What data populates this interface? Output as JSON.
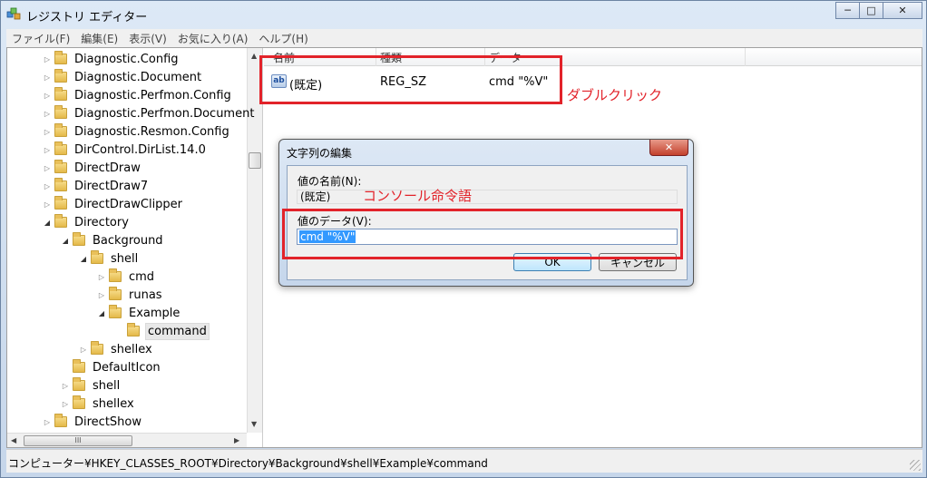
{
  "window": {
    "title": "レジストリ エディター",
    "controls": {
      "minimize": "─",
      "maximize": "□",
      "close": "✕"
    }
  },
  "menu": [
    "ファイル(F)",
    "編集(E)",
    "表示(V)",
    "お気に入り(A)",
    "ヘルプ(H)"
  ],
  "tree": {
    "items": [
      {
        "label": "Diagnostic.Config",
        "depth": 2,
        "expander": "closed"
      },
      {
        "label": "Diagnostic.Document",
        "depth": 2,
        "expander": "closed"
      },
      {
        "label": "Diagnostic.Perfmon.Config",
        "depth": 2,
        "expander": "closed"
      },
      {
        "label": "Diagnostic.Perfmon.Document",
        "depth": 2,
        "expander": "closed"
      },
      {
        "label": "Diagnostic.Resmon.Config",
        "depth": 2,
        "expander": "closed"
      },
      {
        "label": "DirControl.DirList.14.0",
        "depth": 2,
        "expander": "closed"
      },
      {
        "label": "DirectDraw",
        "depth": 2,
        "expander": "closed"
      },
      {
        "label": "DirectDraw7",
        "depth": 2,
        "expander": "closed"
      },
      {
        "label": "DirectDrawClipper",
        "depth": 2,
        "expander": "closed"
      },
      {
        "label": "Directory",
        "depth": 2,
        "expander": "open"
      },
      {
        "label": "Background",
        "depth": 3,
        "expander": "open"
      },
      {
        "label": "shell",
        "depth": 4,
        "expander": "open"
      },
      {
        "label": "cmd",
        "depth": 5,
        "expander": "closed"
      },
      {
        "label": "runas",
        "depth": 5,
        "expander": "closed"
      },
      {
        "label": "Example",
        "depth": 5,
        "expander": "open"
      },
      {
        "label": "command",
        "depth": 6,
        "expander": "none",
        "selected": true
      },
      {
        "label": "shellex",
        "depth": 4,
        "expander": "closed"
      },
      {
        "label": "DefaultIcon",
        "depth": 3,
        "expander": "none"
      },
      {
        "label": "shell",
        "depth": 3,
        "expander": "closed"
      },
      {
        "label": "shellex",
        "depth": 3,
        "expander": "closed"
      },
      {
        "label": "DirectShow",
        "depth": 2,
        "expander": "closed"
      }
    ],
    "hscroll_label": "III"
  },
  "list": {
    "columns": [
      "名前",
      "種類",
      "データ"
    ],
    "rows": [
      {
        "icon": "ab",
        "name": "(既定)",
        "type": "REG_SZ",
        "data": "cmd \"%V\""
      }
    ]
  },
  "annotations": {
    "double_click": "ダブルクリック",
    "console_command": "コンソール命令語"
  },
  "dialog": {
    "title": "文字列の編集",
    "close": "✕",
    "name_label": "値の名前(N):",
    "name_value": "(既定)",
    "data_label": "値のデータ(V):",
    "data_value": "cmd \"%V\"",
    "ok": "OK",
    "cancel": "キャンセル"
  },
  "status": {
    "path": "コンピューター¥HKEY_CLASSES_ROOT¥Directory¥Background¥shell¥Example¥command"
  },
  "colors": {
    "annotation": "#e2232a",
    "selection": "#3399ff"
  }
}
